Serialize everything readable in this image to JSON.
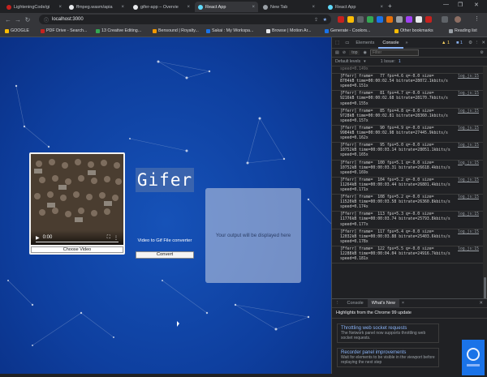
{
  "tabs": [
    {
      "label": "LighteningCode/gi",
      "active": false,
      "color": "#c5221f"
    },
    {
      "label": "ffmpeg.wasm/apia",
      "active": false,
      "color": "#e8eaed"
    },
    {
      "label": "gifer-app – Overvie",
      "active": false,
      "color": "#e8eaed"
    },
    {
      "label": "React App",
      "active": true,
      "color": "#61dafb"
    },
    {
      "label": "New Tab",
      "active": false,
      "color": "#9aa0a6"
    },
    {
      "label": "React App",
      "active": false,
      "color": "#61dafb"
    }
  ],
  "address": "localhost:3000",
  "bookmarks": [
    {
      "label": "GOOGLE",
      "color": "#fbbc04"
    },
    {
      "label": "PDF Drive - Search...",
      "color": "#c5221f"
    },
    {
      "label": "13 Creative Editing...",
      "color": "#34a853"
    },
    {
      "label": "Bensound | Royalty...",
      "color": "#f29900"
    },
    {
      "label": "Sakai : My Workspa...",
      "color": "#1a73e8"
    },
    {
      "label": "Browse | Motion Ar...",
      "color": "#e8eaed"
    },
    {
      "label": "Generate - Coolors...",
      "color": "#1a73e8"
    },
    {
      "label": "Other bookmarks",
      "color": "#fbbc04"
    },
    {
      "label": "Reading list",
      "color": "#9aa0a6"
    }
  ],
  "app": {
    "title": "Gifer",
    "subtitle": "Video to Gif File converter",
    "convert_label": "Convert",
    "choose_label": "Choose Video",
    "video_time": "0:00",
    "output_placeholder": "Your output will be displayed here"
  },
  "devtools": {
    "tabs": [
      "Elements",
      "Console"
    ],
    "active_tab": "Console",
    "context": "top",
    "filter_placeholder": "Filter",
    "levels": "Default levels",
    "issues": "1 Issue:",
    "issue_count": "1",
    "messages": [
      {
        "line1": "[Fferr] frame=   77 fps=4.6 q=-0.0 size=",
        "line2": "8704kB time=00:00:02.54 bitrate=28072.1kbits/s",
        "line3": "speed=0.151x",
        "src": "log.js:15"
      },
      {
        "line1": "[Fferr] frame=   81 fps=4.7 q=-0.0 size=",
        "line2": "9216kB time=00:00:02.68 bitrate=28170.7kbits/s",
        "line3": "speed=0.155x",
        "src": "log.js:15"
      },
      {
        "line1": "[Fferr] frame=   85 fps=4.8 q=-0.0 size=",
        "line2": "9728kB time=00:00:02.81 bitrate=28360.1kbits/s",
        "line3": "speed=0.157x",
        "src": "log.js:15"
      },
      {
        "line1": "[Fferr] frame=   90 fps=4.9 q=-0.0 size=",
        "line2": "9984kB time=00:00:02.98 bitrate=27445.9kbits/s",
        "line3": "speed=0.162x",
        "src": "log.js:15"
      },
      {
        "line1": "[Fferr] frame=   95 fps=5.0 q=-0.0 size=",
        "line2": "10752kB time=00:00:03.14 bitrate=28051.1kbits/s",
        "line3": "speed=0.165x",
        "src": "log.js:15"
      },
      {
        "line1": "[Fferr] frame=  100 fps=5.1 q=-0.0 size=",
        "line2": "10752kB time=00:00:03.31 bitrate=26618.4kbits/s",
        "line3": "speed=0.169x",
        "src": "log.js:15"
      },
      {
        "line1": "[Fferr] frame=  104 fps=5.2 q=-0.0 size=",
        "line2": "11264kB time=00:00:03.44 bitrate=26801.4kbits/s",
        "line3": "speed=0.171x",
        "src": "log.js:15"
      },
      {
        "line1": "[Fferr] frame=  108 fps=5.2 q=-0.0 size=",
        "line2": "11520kB time=00:00:03.58 bitrate=26360.8kbits/s",
        "line3": "speed=0.174x",
        "src": "log.js:15"
      },
      {
        "line1": "[Fferr] frame=  113 fps=5.3 q=-0.0 size=",
        "line2": "11776kB time=00:00:03.74 bitrate=25793.8kbits/s",
        "line3": "speed=0.177x",
        "src": "log.js:15"
      },
      {
        "line1": "[Fferr] frame=  117 fps=5.4 q=-0.0 size=",
        "line2": "12032kB time=00:00:03.88 bitrate=25403.6kbits/s",
        "line3": "speed=0.178x",
        "src": "log.js:15"
      },
      {
        "line1": "[Fferr] frame=  122 fps=5.5 q=-0.0 size=",
        "line2": "12288kB time=00:00:04.04 bitrate=24916.7kbits/s",
        "line3": "speed=0.181x",
        "src": "log.js:15"
      }
    ],
    "drawer_tabs": [
      "Console",
      "What's New"
    ],
    "drawer_active": "What's New",
    "highlights": "Highlights from the Chrome 99 update",
    "news": [
      {
        "title": "Throttling web socket requests",
        "body": "The Network panel now supports throttling web socket requests."
      },
      {
        "title": "Recorder panel improvements",
        "body": "Wait for elements to be visible in the viewport before replaying the next step"
      }
    ]
  }
}
